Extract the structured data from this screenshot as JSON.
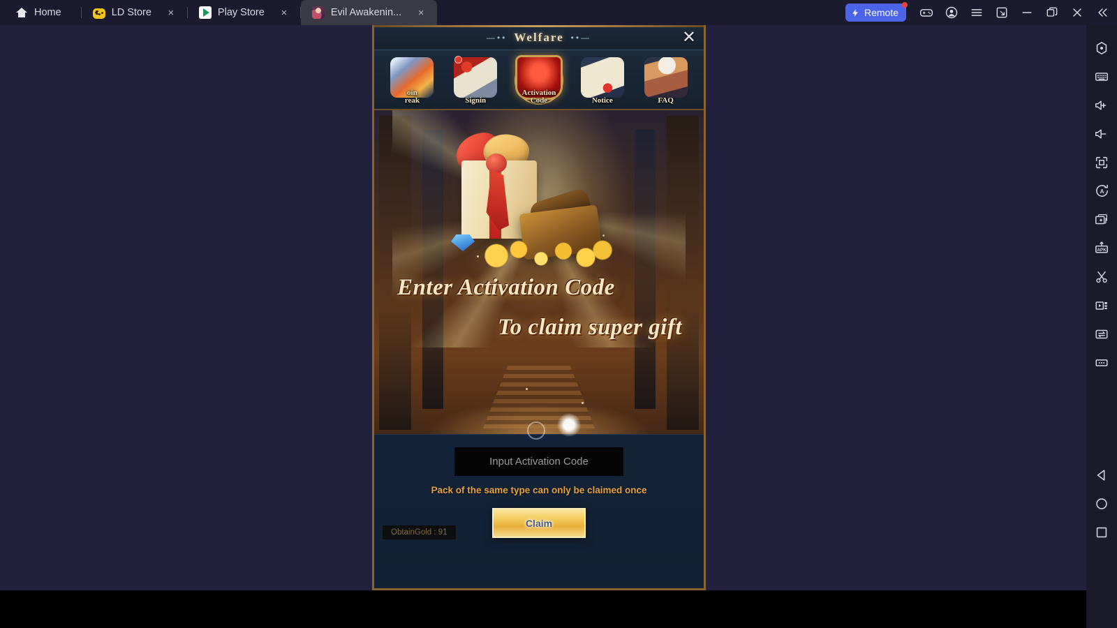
{
  "window": {
    "background_color": "#23213d",
    "tabs": [
      {
        "label": "Home",
        "icon": "home-icon",
        "closable": false,
        "active": false
      },
      {
        "label": "LD Store",
        "icon": "gamepad-icon",
        "closable": true,
        "active": false
      },
      {
        "label": "Play Store",
        "icon": "play-store-icon",
        "closable": true,
        "active": false
      },
      {
        "label": "Evil Awakenin...",
        "icon": "game-avatar-icon",
        "closable": true,
        "active": true
      }
    ],
    "close_glyph": "×",
    "controls": {
      "remote_label": "Remote",
      "remote_color": "#4b64ea",
      "notification_dot_color": "#ec4040",
      "buttons": [
        {
          "name": "gamepad-button"
        },
        {
          "name": "account-button"
        },
        {
          "name": "menu-button"
        },
        {
          "name": "fullscreen-button"
        },
        {
          "name": "minimize-button"
        },
        {
          "name": "maximize-button"
        },
        {
          "name": "close-window-button"
        },
        {
          "name": "collapse-sidebar-button"
        }
      ]
    }
  },
  "sidebar": {
    "items": [
      {
        "name": "location-icon"
      },
      {
        "name": "keyboard-icon"
      },
      {
        "name": "volume-up-icon"
      },
      {
        "name": "volume-down-icon"
      },
      {
        "name": "fullscreen-icon"
      },
      {
        "name": "auto-rotate-icon"
      },
      {
        "name": "multi-instance-icon"
      },
      {
        "name": "install-apk-icon",
        "text": "APK"
      },
      {
        "name": "scissors-icon"
      },
      {
        "name": "video-record-icon"
      },
      {
        "name": "sync-transfer-icon"
      },
      {
        "name": "more-options-icon"
      }
    ],
    "nav": [
      {
        "name": "android-back-button"
      },
      {
        "name": "android-home-button"
      },
      {
        "name": "android-recents-button"
      }
    ]
  },
  "game": {
    "dialog": {
      "title": "Welfare",
      "title_deco_left": "—••",
      "title_deco_right": "••—",
      "close_glyph": "✕",
      "tabs": [
        {
          "id": "coin-break",
          "label_line1": "oin",
          "label_line2": "reak",
          "badge": false,
          "active": false
        },
        {
          "id": "signin",
          "label_line1": "Signin",
          "label_line2": "",
          "badge": true,
          "active": false
        },
        {
          "id": "activation-code",
          "label_line1": "Activation",
          "label_line2": "Code",
          "badge": false,
          "active": true
        },
        {
          "id": "notice",
          "label_line1": "Notice",
          "label_line2": "",
          "badge": false,
          "active": false
        },
        {
          "id": "faq",
          "label_line1": "FAQ",
          "label_line2": "",
          "badge": false,
          "active": false
        }
      ],
      "banner": {
        "headline_line1": "Enter Activation Code",
        "headline_line2": "To claim super gift"
      },
      "input_placeholder": "Input Activation Code",
      "input_value": "",
      "note": "Pack of the same type can only be claimed once",
      "claim_label": "Claim",
      "gold_badge": "ObtainGold : 91",
      "colors": {
        "frame_gold": "#8a6330",
        "title_text": "#e8dcc0",
        "note_orange": "#e8a33c",
        "claim_gold": "#f4cf63"
      }
    }
  }
}
